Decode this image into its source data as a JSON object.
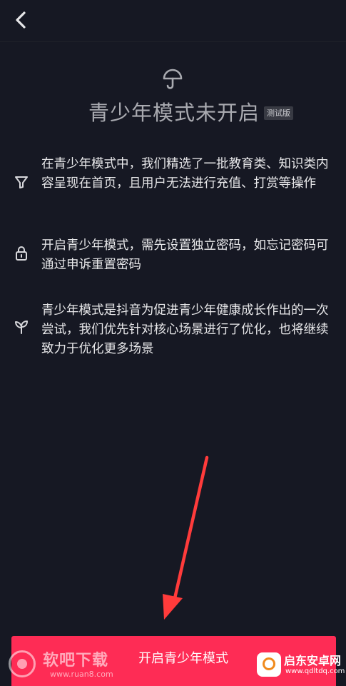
{
  "header": {
    "back_icon": "chevron-left-icon"
  },
  "hero": {
    "icon": "umbrella-icon",
    "title": "青少年模式未开启",
    "badge": "测试版"
  },
  "features": [
    {
      "icon": "filter-icon",
      "text": "在青少年模式中，我们精选了一批教育类、知识类内容呈现在首页，且用户无法进行充值、打赏等操作"
    },
    {
      "icon": "lock-icon",
      "text": "开启青少年模式，需先设置独立密码，如忘记密码可通过申诉重置密码"
    },
    {
      "icon": "sprout-icon",
      "text": "青少年模式是抖音为促进青少年健康成长作出的一次尝试，我们优先针对核心场景进行了优化，也将继续致力于优化更多场景"
    }
  ],
  "cta": {
    "label": "开启青少年模式"
  },
  "watermarks": {
    "left_name": "软吧下载",
    "left_url": "www.ruan8.com",
    "right_name": "启东安卓网",
    "right_url": "www.qdltdq.com"
  },
  "colors": {
    "background": "#161823",
    "accent": "#fe2c55",
    "arrow": "#ff3b3b"
  }
}
